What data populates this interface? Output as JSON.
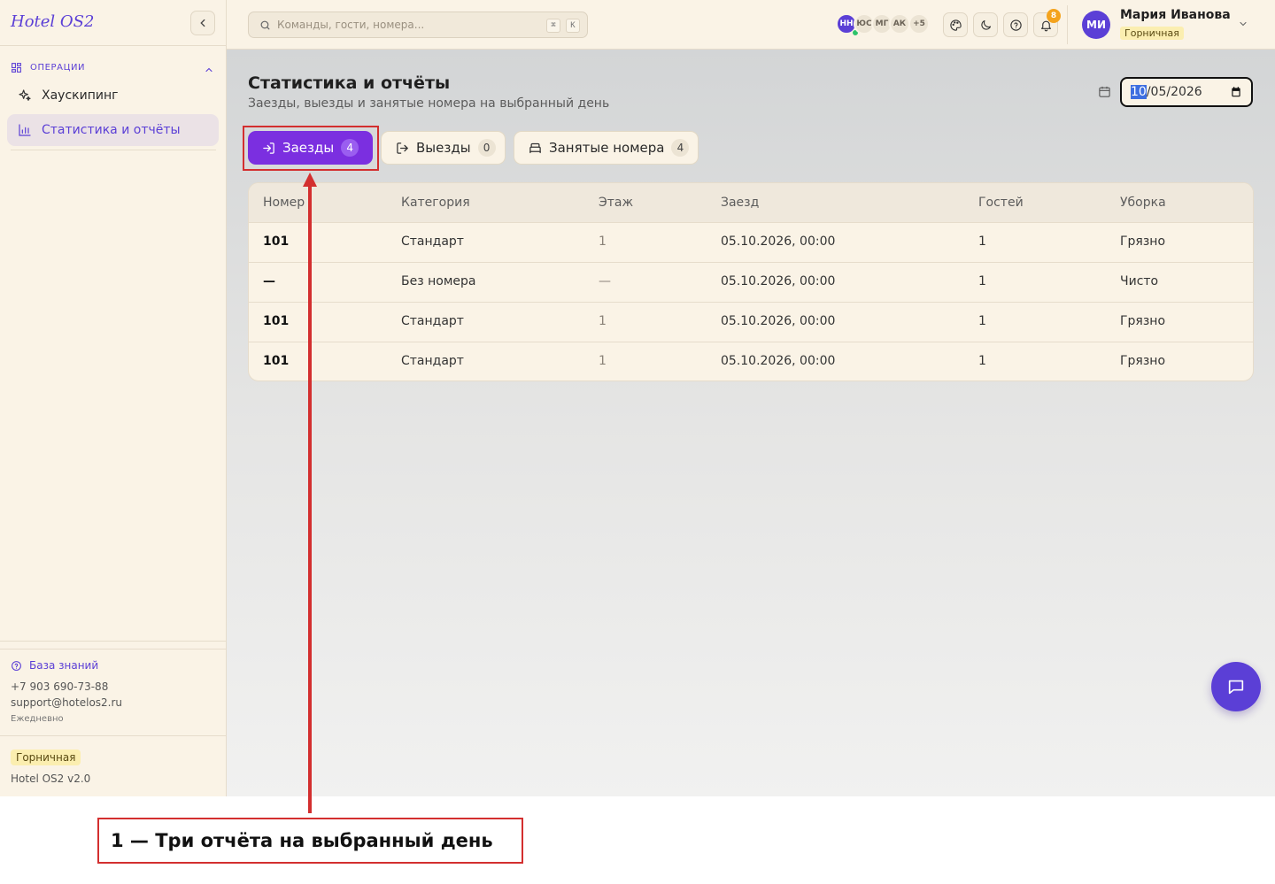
{
  "sidebar": {
    "logo": "Hotel OS2",
    "section_label": "ОПЕРАЦИИ",
    "items": [
      {
        "label": "Хаускипинг",
        "icon": "sparkles-icon"
      },
      {
        "label": "Статистика и отчёты",
        "icon": "bar-chart-icon",
        "active": true
      }
    ],
    "footer": {
      "knowledge_base": "База знаний",
      "phone": "+7 903 690-73-88",
      "email": "support@hotelos2.ru",
      "hours": "Ежедневно",
      "role": "Горничная",
      "version": "Hotel OS2 v2.0"
    }
  },
  "topbar": {
    "search_placeholder": "Команды, гости, номера...",
    "shortcut_keys": [
      "⌘",
      "K"
    ],
    "presence": [
      "НН",
      "ЮС",
      "МГ",
      "АК",
      "+5"
    ],
    "notifications_count": "8",
    "user": {
      "initials": "МИ",
      "name": "Мария Иванова",
      "role": "Горничная"
    }
  },
  "page": {
    "title": "Статистика и отчёты",
    "subtitle": "Заезды, выезды и занятые номера на выбранный день",
    "date": {
      "month": "10",
      "rest": "/05/2026"
    },
    "tabs": [
      {
        "label": "Заезды",
        "count": "4",
        "icon": "login-icon",
        "active": true
      },
      {
        "label": "Выезды",
        "count": "0",
        "icon": "logout-icon",
        "active": false
      },
      {
        "label": "Занятые номера",
        "count": "4",
        "icon": "bed-icon",
        "active": false
      }
    ],
    "table": {
      "headers": [
        "Номер",
        "Категория",
        "Этаж",
        "Заезд",
        "Гостей",
        "Уборка"
      ],
      "rows": [
        [
          "101",
          "Стандарт",
          "1",
          "05.10.2026, 00:00",
          "1",
          "Грязно"
        ],
        [
          "—",
          "Без номера",
          "—",
          "05.10.2026, 00:00",
          "1",
          "Чисто"
        ],
        [
          "101",
          "Стандарт",
          "1",
          "05.10.2026, 00:00",
          "1",
          "Грязно"
        ],
        [
          "101",
          "Стандарт",
          "1",
          "05.10.2026, 00:00",
          "1",
          "Грязно"
        ]
      ]
    }
  },
  "annotation": {
    "callout": "1 — Три отчёта на выбранный день",
    "color": "#d32f2f"
  },
  "colors": {
    "accent": "#5b3fd6",
    "tab_active": "#7b2fe0",
    "sidebar_bg": "#faf3e6",
    "badge_bg": "#fbeeb0",
    "notification": "#f4a31d"
  }
}
